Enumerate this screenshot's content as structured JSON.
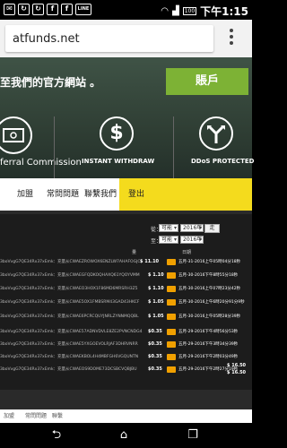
{
  "statusbar": {
    "icons": [
      "✉",
      "↻",
      "↻",
      "f",
      "f",
      "LINE"
    ],
    "battery": "100",
    "time": "下午1:15"
  },
  "browser": {
    "url": "atfunds.net"
  },
  "hero": {
    "title": "至我們的官方網站 。",
    "account_button": "賬戶",
    "features": [
      {
        "label": "ferral Commission",
        "icon": "money-icon"
      },
      {
        "label": "INSTANT WITHDRAW",
        "icon": "dollar-circle-icon"
      },
      {
        "label": "DDoS PROTECTED",
        "icon": "split-arrows-icon"
      }
    ]
  },
  "nav": {
    "items": [
      "加盟",
      "常問問題",
      "聯繫我們"
    ],
    "logout": "登出"
  },
  "filters": {
    "from_label": "從：",
    "to_label": "至：",
    "from_month": "可能",
    "from_day": "1",
    "from_year": "2016年",
    "to_month": "可能",
    "to_day": "31",
    "to_year": "2016年",
    "go_button": "走"
  },
  "table": {
    "header_amount": "量",
    "header_date": "日期",
    "rows": [
      {
        "id": "3boVvgG7QE34Rx37xEmk：充量从CWAEZROWOX6ENZLW7AHAFOGJC",
        "amount": "$ 11.10",
        "date": "五月-31-2016上午05時04分18秒"
      },
      {
        "id": "3boVvgG7QE34Rx37xEmk：充量从CWAEGFQDKOQHAXQ61YQOYVMM",
        "amount": "$ 1.10",
        "date": "五月-30-2016下午8時55分18秒"
      },
      {
        "id": "3boVvgG7QE34Rx37xEmk：充量从CWAEO3HOX1F86MD6MRSRH3Z5",
        "amount": "$ 1.10",
        "date": "五月-30-2016上午07時23分42秒"
      },
      {
        "id": "3boVvgG7QE34Rx37xEmk：充量从CWAE5OX1FMBSRM43GAD43HKCF",
        "amount": "$ 1.05",
        "date": "五月-30-2016上午6時20分91分9秒"
      },
      {
        "id": "3boVvgG7QE34Rx37xEmk：充量从CWAE6PCRCQUYJNRLZYNNMQQBL",
        "amount": "$ 1.05",
        "date": "五月-30-2016上午05時28分39秒"
      },
      {
        "id": "3boVvgG7QE34Rx37xEmk：充量从CWAE57ADNVDVLE8ZE2PVNCNDG4",
        "amount": "$0.35",
        "date": "五月-29-2016下午4時56分53秒"
      },
      {
        "id": "3boVvgG7QE34Rx37xEmk：充量从CWAE5YXGOEVOLRJAF3DHRVNRR",
        "amount": "$0.35",
        "date": "五月-29-2016下午3時34分39秒"
      },
      {
        "id": "3boVvgG7QE34Rx37xEmk：充量从CWAEKBOL4H4MBFGH6VGQUNTN",
        "amount": "$0.35",
        "date": "五月-29-2016下午2時03分49秒"
      },
      {
        "id": "3boVvgG7QE34Rx37xEmk：充量从CWAEOS9DOME73DCSBCVQBJBU",
        "amount": "$0.35",
        "date": "五月-29-2016下午2時27分19秒"
      }
    ],
    "totals": [
      "$ 16.50",
      "$ 16.50"
    ]
  },
  "footer": {
    "links": [
      "加盟",
      "常問問題",
      "聯繫"
    ]
  },
  "colors": {
    "accent_green": "#7db235",
    "accent_yellow": "#f4db1d"
  }
}
